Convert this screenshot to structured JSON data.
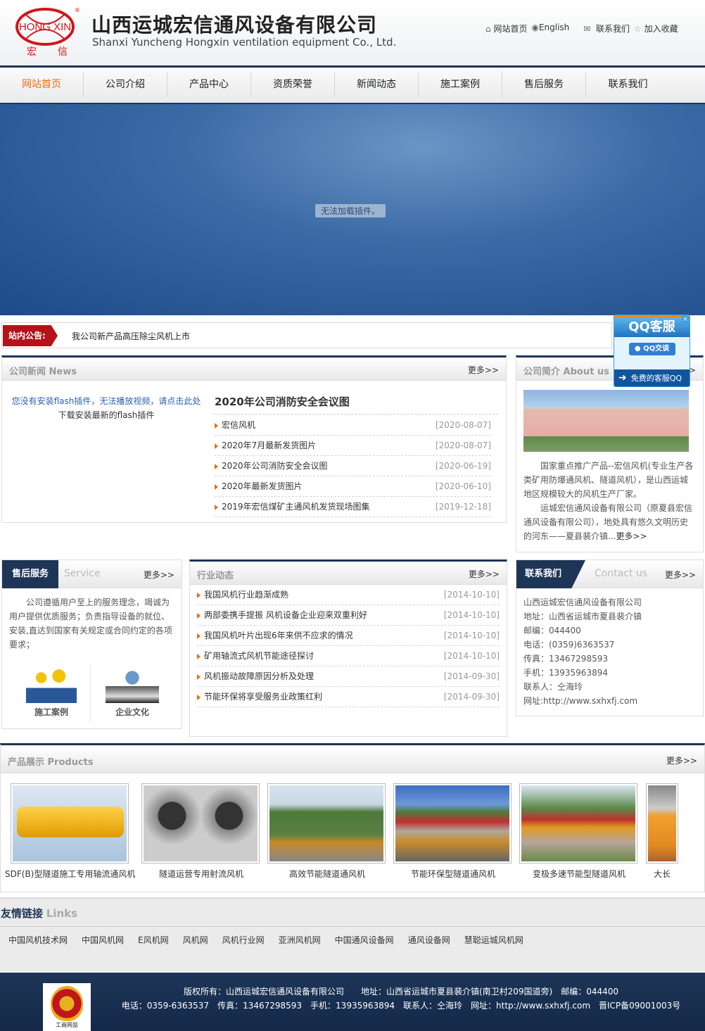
{
  "header": {
    "logo_text": "HONG XIN 宏 信",
    "company_cn": "山西运城宏信通风设备有限公司",
    "company_en": "Shanxi Yuncheng Hongxin ventilation equipment Co., Ltd.",
    "top_links": [
      {
        "icon": "home-icon",
        "label": "网站首页"
      },
      {
        "icon": "globe-icon",
        "label": "English"
      },
      {
        "icon": "mail-icon",
        "label": "联系我们"
      },
      {
        "icon": "star-icon",
        "label": "加入收藏"
      }
    ]
  },
  "nav": {
    "items": [
      "网站首页",
      "公司介绍",
      "产品中心",
      "资质荣誉",
      "新闻动态",
      "施工案例",
      "售后服务",
      "联系我们"
    ],
    "active": "网站首页"
  },
  "banner": {
    "message": "无法加载插件。"
  },
  "notice": {
    "label": "站内公告:",
    "text": "我公司新产品高压除尘风机上市"
  },
  "news": {
    "title": "公司新闻 News",
    "more": "更多>>",
    "flash_msg": "您没有安装flash插件，无法播放视频，请点击此处",
    "flash_link": "下载安装最新的flash插件",
    "headline": "2020年公司消防安全会议图",
    "items": [
      {
        "title": "宏信风机",
        "date": "[2020-08-07]"
      },
      {
        "title": "2020年7月最新发货图片",
        "date": "[2020-08-07]"
      },
      {
        "title": "2020年公司消防安全会议图",
        "date": "[2020-06-19]"
      },
      {
        "title": "2020年最新发货图片",
        "date": "[2020-06-10]"
      },
      {
        "title": "2019年宏信煤矿主通风机发货现场图集",
        "date": "[2019-12-18]"
      }
    ]
  },
  "about": {
    "title": "公司简介 About us",
    "more": "更多>>",
    "p1": "国家重点推广产品--宏信风机(专业生产各类矿用防爆通风机、隧道风机），是山西运城地区规模较大的风机生产厂家。",
    "p2": "运城宏信通风设备有限公司（原夏县宏信通风设备有限公司），地处具有悠久文明历史的河东——夏县裴介镇...",
    "p2_more": "更多>>"
  },
  "qq": {
    "title": "QQ客服",
    "button": "QQ交谈",
    "footer": "免费的客服QQ"
  },
  "service": {
    "title": "售后服务",
    "subtitle": "Service",
    "more": "更多>>",
    "text": "公司遵循用户至上的服务理念，竭诚为用户提供优质服务；负责指导设备的就位、安装,直达到国家有关规定或合同约定的各项要求；",
    "links": [
      "施工案例",
      "企业文化"
    ]
  },
  "industry": {
    "title": "行业动态",
    "more": "更多>>",
    "items": [
      {
        "title": "我国风机行业趋渐成熟",
        "date": "[2014-10-10]"
      },
      {
        "title": "两部委携手提振 风机设备企业迎来双重利好",
        "date": "[2014-10-10]"
      },
      {
        "title": "我国风机叶片出现6年来供不应求的情况",
        "date": "[2014-10-10]"
      },
      {
        "title": "矿用轴流式风机节能途径探讨",
        "date": "[2014-10-10]"
      },
      {
        "title": "风机振动故障原因分析及处理",
        "date": "[2014-09-30]"
      },
      {
        "title": "节能环保将享受服务业政策红利",
        "date": "[2014-09-30]"
      }
    ]
  },
  "contact": {
    "title": "联系我们",
    "subtitle": "Contact us",
    "more": "更多>>",
    "lines": [
      "山西运城宏信通风设备有限公司",
      "地址：山西省运城市夏县裴介镇",
      "邮编：044400",
      "电话：(0359)6363537",
      "传真：13467298593",
      "手机：13935963894",
      "联系人：仝海玲",
      "网址:http://www.sxhxfj.com"
    ]
  },
  "products": {
    "title": "产品展示 Products",
    "more": "更多>>",
    "items": [
      "SDF(B)型隧道施工专用轴流通风机",
      "隧道运营专用射流风机",
      "高效节能隧道通风机",
      "节能环保型隧道通风机",
      "变极多速节能型隧道风机",
      "大长"
    ]
  },
  "links": {
    "title": "友情链接",
    "subtitle": "Links",
    "items": [
      "中国风机技术网",
      "中国风机网",
      "E风机网",
      "风机网",
      "风机行业网",
      "亚洲风机网",
      "中国通风设备网",
      "通风设备网",
      "慧聪运城风机网"
    ]
  },
  "footer": {
    "line1": "版权所有：山西运城宏信通风设备有限公司　　地址：山西省运城市夏县裴介镇(南卫村209国道旁)　邮编：044400",
    "line2": "电话：0359-6363537　传真：13467298593　手机：13935963894　联系人：仝海玲　网址：http://www.sxhxfj.com　晋ICP备09001003号",
    "badge": "工商网监"
  },
  "colors": {
    "navy": "#1d3557",
    "accent": "#f06a10",
    "notice_red": "#b5121b"
  }
}
